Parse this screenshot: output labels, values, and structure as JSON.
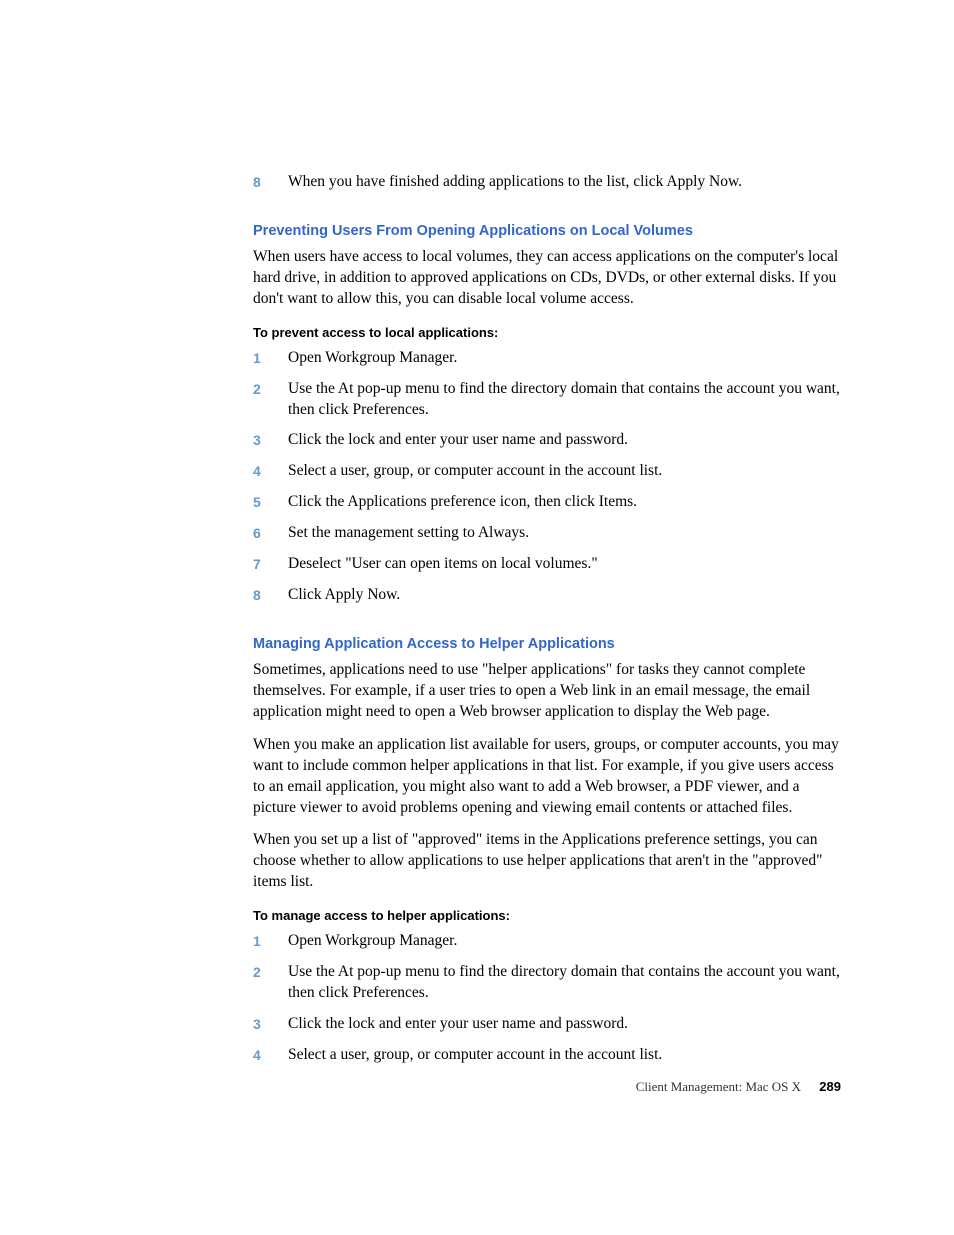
{
  "intro_step": {
    "num": "8",
    "text": "When you have finished adding applications to the list, click Apply Now."
  },
  "section1": {
    "heading": "Preventing Users From Opening Applications on Local Volumes",
    "para1": "When users have access to local volumes, they can access applications on the computer's local hard drive, in addition to approved applications on CDs, DVDs, or other external disks. If you don't want to allow this, you can disable local volume access.",
    "subhead": "To prevent access to local applications:",
    "steps": [
      {
        "num": "1",
        "text": "Open Workgroup Manager."
      },
      {
        "num": "2",
        "text": "Use the At pop-up menu to find the directory domain that contains the account you want, then click Preferences."
      },
      {
        "num": "3",
        "text": "Click the lock and enter your user name and password."
      },
      {
        "num": "4",
        "text": "Select a user, group, or computer account in the account list."
      },
      {
        "num": "5",
        "text": "Click the Applications preference icon, then click Items."
      },
      {
        "num": "6",
        "text": "Set the management setting to Always."
      },
      {
        "num": "7",
        "text": "Deselect \"User can open items on local volumes.\""
      },
      {
        "num": "8",
        "text": "Click Apply Now."
      }
    ]
  },
  "section2": {
    "heading": "Managing Application Access to Helper Applications",
    "para1": "Sometimes, applications need to use \"helper applications\" for tasks they cannot complete themselves. For example, if a user tries to open a Web link in an email message, the email application might need to open a Web browser application to display the Web page.",
    "para2": "When you make an application list available for users, groups, or computer accounts, you may want to include common helper applications in that list. For example, if you give users access to an email application, you might also want to add a Web browser, a PDF viewer, and a picture viewer to avoid problems opening and viewing email contents or attached files.",
    "para3": "When you set up a list of \"approved\" items in the Applications preference settings, you can choose whether to allow applications to use helper applications that aren't in the \"approved\" items list.",
    "subhead": "To manage access to helper applications:",
    "steps": [
      {
        "num": "1",
        "text": "Open Workgroup Manager."
      },
      {
        "num": "2",
        "text": "Use the At pop-up menu to find the directory domain that contains the account you want, then click Preferences."
      },
      {
        "num": "3",
        "text": "Click the lock and enter your user name and password."
      },
      {
        "num": "4",
        "text": "Select a user, group, or computer account in the account list."
      }
    ]
  },
  "footer": {
    "label": "Client Management: Mac OS X",
    "page": "289"
  }
}
